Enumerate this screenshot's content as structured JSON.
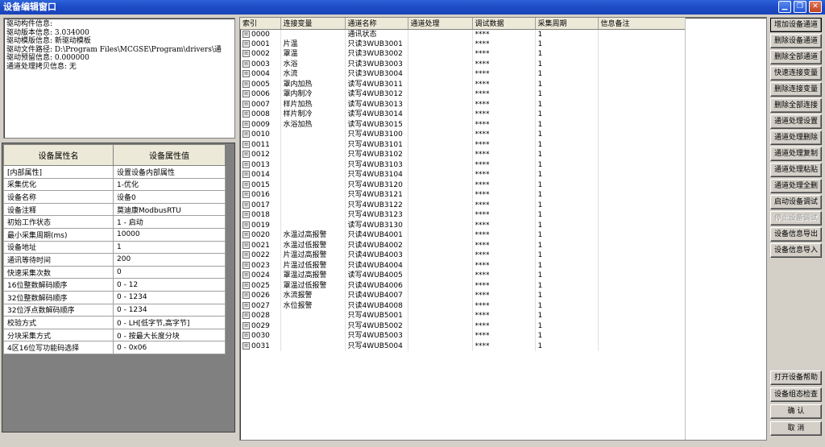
{
  "window": {
    "title": "设备编辑窗口"
  },
  "driver_info": [
    "驱动构件信息:",
    "驱动版本信息: 3.034000",
    "驱动模版信息: 新驱动模板",
    "驱动文件路径: D:\\Program Files\\MCGSE\\Program\\drivers\\通",
    "驱动预留信息: 0.000000",
    "通道处理拷贝信息: 无"
  ],
  "properties": {
    "headers": [
      "设备属性名",
      "设备属性值"
    ],
    "rows": [
      [
        "[内部属性]",
        "设置设备内部属性"
      ],
      [
        "采集优化",
        "1-优化"
      ],
      [
        "设备名称",
        "设备0"
      ],
      [
        "设备注释",
        "莫迪康ModbusRTU"
      ],
      [
        "初始工作状态",
        "1 - 启动"
      ],
      [
        "最小采集周期(ms)",
        "10000"
      ],
      [
        "设备地址",
        "1"
      ],
      [
        "通讯等待时间",
        "200"
      ],
      [
        "快速采集次数",
        "0"
      ],
      [
        "16位整数解码顺序",
        "0 - 12"
      ],
      [
        "32位整数解码顺序",
        "0 - 1234"
      ],
      [
        "32位浮点数解码顺序",
        "0 - 1234"
      ],
      [
        "校验方式",
        "0 - LH[低字节,高字节]"
      ],
      [
        "分块采集方式",
        "0 - 按最大长度分块"
      ],
      [
        "4区16位写功能码选择",
        "0 - 0x06"
      ]
    ]
  },
  "channels": {
    "headers": [
      "索引",
      "连接变量",
      "通道名称",
      "通道处理",
      "调试数据",
      "采集周期",
      "信息备注"
    ],
    "rows": [
      [
        "0000",
        "",
        "通讯状态",
        "",
        "****",
        "1",
        ""
      ],
      [
        "0001",
        "片温",
        "只读3WUB3001",
        "",
        "****",
        "1",
        ""
      ],
      [
        "0002",
        "罩温",
        "只读3WUB3002",
        "",
        "****",
        "1",
        ""
      ],
      [
        "0003",
        "水浴",
        "只读3WUB3003",
        "",
        "****",
        "1",
        ""
      ],
      [
        "0004",
        "水流",
        "只读3WUB3004",
        "",
        "****",
        "1",
        ""
      ],
      [
        "0005",
        "罩内加热",
        "读写4WUB3011",
        "",
        "****",
        "1",
        ""
      ],
      [
        "0006",
        "罩内制冷",
        "读写4WUB3012",
        "",
        "****",
        "1",
        ""
      ],
      [
        "0007",
        "样片加热",
        "读写4WUB3013",
        "",
        "****",
        "1",
        ""
      ],
      [
        "0008",
        "样片制冷",
        "读写4WUB3014",
        "",
        "****",
        "1",
        ""
      ],
      [
        "0009",
        "水浴加热",
        "读写4WUB3015",
        "",
        "****",
        "1",
        ""
      ],
      [
        "0010",
        "",
        "只写4WUB3100",
        "",
        "****",
        "1",
        ""
      ],
      [
        "0011",
        "",
        "只写4WUB3101",
        "",
        "****",
        "1",
        ""
      ],
      [
        "0012",
        "",
        "只写4WUB3102",
        "",
        "****",
        "1",
        ""
      ],
      [
        "0013",
        "",
        "只写4WUB3103",
        "",
        "****",
        "1",
        ""
      ],
      [
        "0014",
        "",
        "只写4WUB3104",
        "",
        "****",
        "1",
        ""
      ],
      [
        "0015",
        "",
        "只写4WUB3120",
        "",
        "****",
        "1",
        ""
      ],
      [
        "0016",
        "",
        "只写4WUB3121",
        "",
        "****",
        "1",
        ""
      ],
      [
        "0017",
        "",
        "只写4WUB3122",
        "",
        "****",
        "1",
        ""
      ],
      [
        "0018",
        "",
        "只写4WUB3123",
        "",
        "****",
        "1",
        ""
      ],
      [
        "0019",
        "",
        "读写4WUB3130",
        "",
        "****",
        "1",
        ""
      ],
      [
        "0020",
        "水温过高报警",
        "只读4WUB4001",
        "",
        "****",
        "1",
        ""
      ],
      [
        "0021",
        "水温过低报警",
        "只读4WUB4002",
        "",
        "****",
        "1",
        ""
      ],
      [
        "0022",
        "片温过高报警",
        "只读4WUB4003",
        "",
        "****",
        "1",
        ""
      ],
      [
        "0023",
        "片温过低报警",
        "只读4WUB4004",
        "",
        "****",
        "1",
        ""
      ],
      [
        "0024",
        "罩温过高报警",
        "读写4WUB4005",
        "",
        "****",
        "1",
        ""
      ],
      [
        "0025",
        "罩温过低报警",
        "只读4WUB4006",
        "",
        "****",
        "1",
        ""
      ],
      [
        "0026",
        "水流报警",
        "只读4WUB4007",
        "",
        "****",
        "1",
        ""
      ],
      [
        "0027",
        "水位报警",
        "只读4WUB4008",
        "",
        "****",
        "1",
        ""
      ],
      [
        "0028",
        "",
        "只写4WUB5001",
        "",
        "****",
        "1",
        ""
      ],
      [
        "0029",
        "",
        "只写4WUB5002",
        "",
        "****",
        "1",
        ""
      ],
      [
        "0030",
        "",
        "只写4WUB5003",
        "",
        "****",
        "1",
        ""
      ],
      [
        "0031",
        "",
        "只写4WUB5004",
        "",
        "****",
        "1",
        ""
      ]
    ]
  },
  "buttons": {
    "add_channel": "增加设备通道",
    "delete_channel": "删除设备通道",
    "delete_all_channels": "删除全部通道",
    "quick_connect": "快速连接变量",
    "delete_connect": "删除连接变量",
    "delete_all_connect": "删除全部连接",
    "chan_proc_set": "通道处理设置",
    "chan_proc_delete": "通道处理删除",
    "chan_proc_copy": "通道处理复制",
    "chan_proc_paste": "通道处理粘贴",
    "chan_proc_delete_all": "通道处理全删",
    "start_debug": "启动设备调试",
    "stop_debug": "停止设备调试",
    "export_info": "设备信息导出",
    "import_info": "设备信息导入",
    "open_help": "打开设备帮助",
    "config_check": "设备组态检查",
    "confirm": "确  认",
    "cancel": "取  消"
  }
}
